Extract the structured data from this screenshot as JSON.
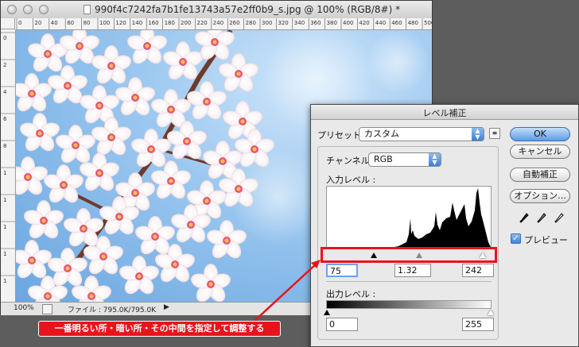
{
  "document": {
    "title": "990f4c7242fa7b1fe13743a57e2ff0b9_s.jpg @ 100% (RGB/8#) *",
    "zoom": "100%",
    "file_info": "ファイル : 795.0K/795.0K",
    "ruler_top_ticks": [
      "0",
      "20",
      "40",
      "60",
      "80",
      "100",
      "120",
      "140",
      "160",
      "180",
      "200",
      "220",
      "240",
      "260",
      "280",
      "300",
      "320",
      "340",
      "360",
      "380",
      "400",
      "420",
      "440",
      "460",
      "480",
      "500"
    ],
    "ruler_left_ticks": [
      "0",
      "2",
      "4",
      "6",
      "8",
      "1",
      "1",
      "1",
      "1",
      "1"
    ]
  },
  "dialog": {
    "title": "レベル補正",
    "preset_label": "プリセット :",
    "preset_value": "カスタム",
    "channel_label": "チャンネル :",
    "channel_value": "RGB",
    "input_levels_label": "入力レベル :",
    "input_black": "75",
    "input_gamma": "1.32",
    "input_white": "242",
    "output_levels_label": "出力レベル :",
    "output_black": "0",
    "output_white": "255",
    "buttons": {
      "ok": "OK",
      "cancel": "キャンセル",
      "auto": "自動補正",
      "options": "オプション..."
    },
    "preview_label": "プレビュー",
    "preview_checked": true
  },
  "annotation": {
    "callout": "一番明るい所・暗い所・その中間を指定して調整する",
    "color": "#e8141b"
  }
}
